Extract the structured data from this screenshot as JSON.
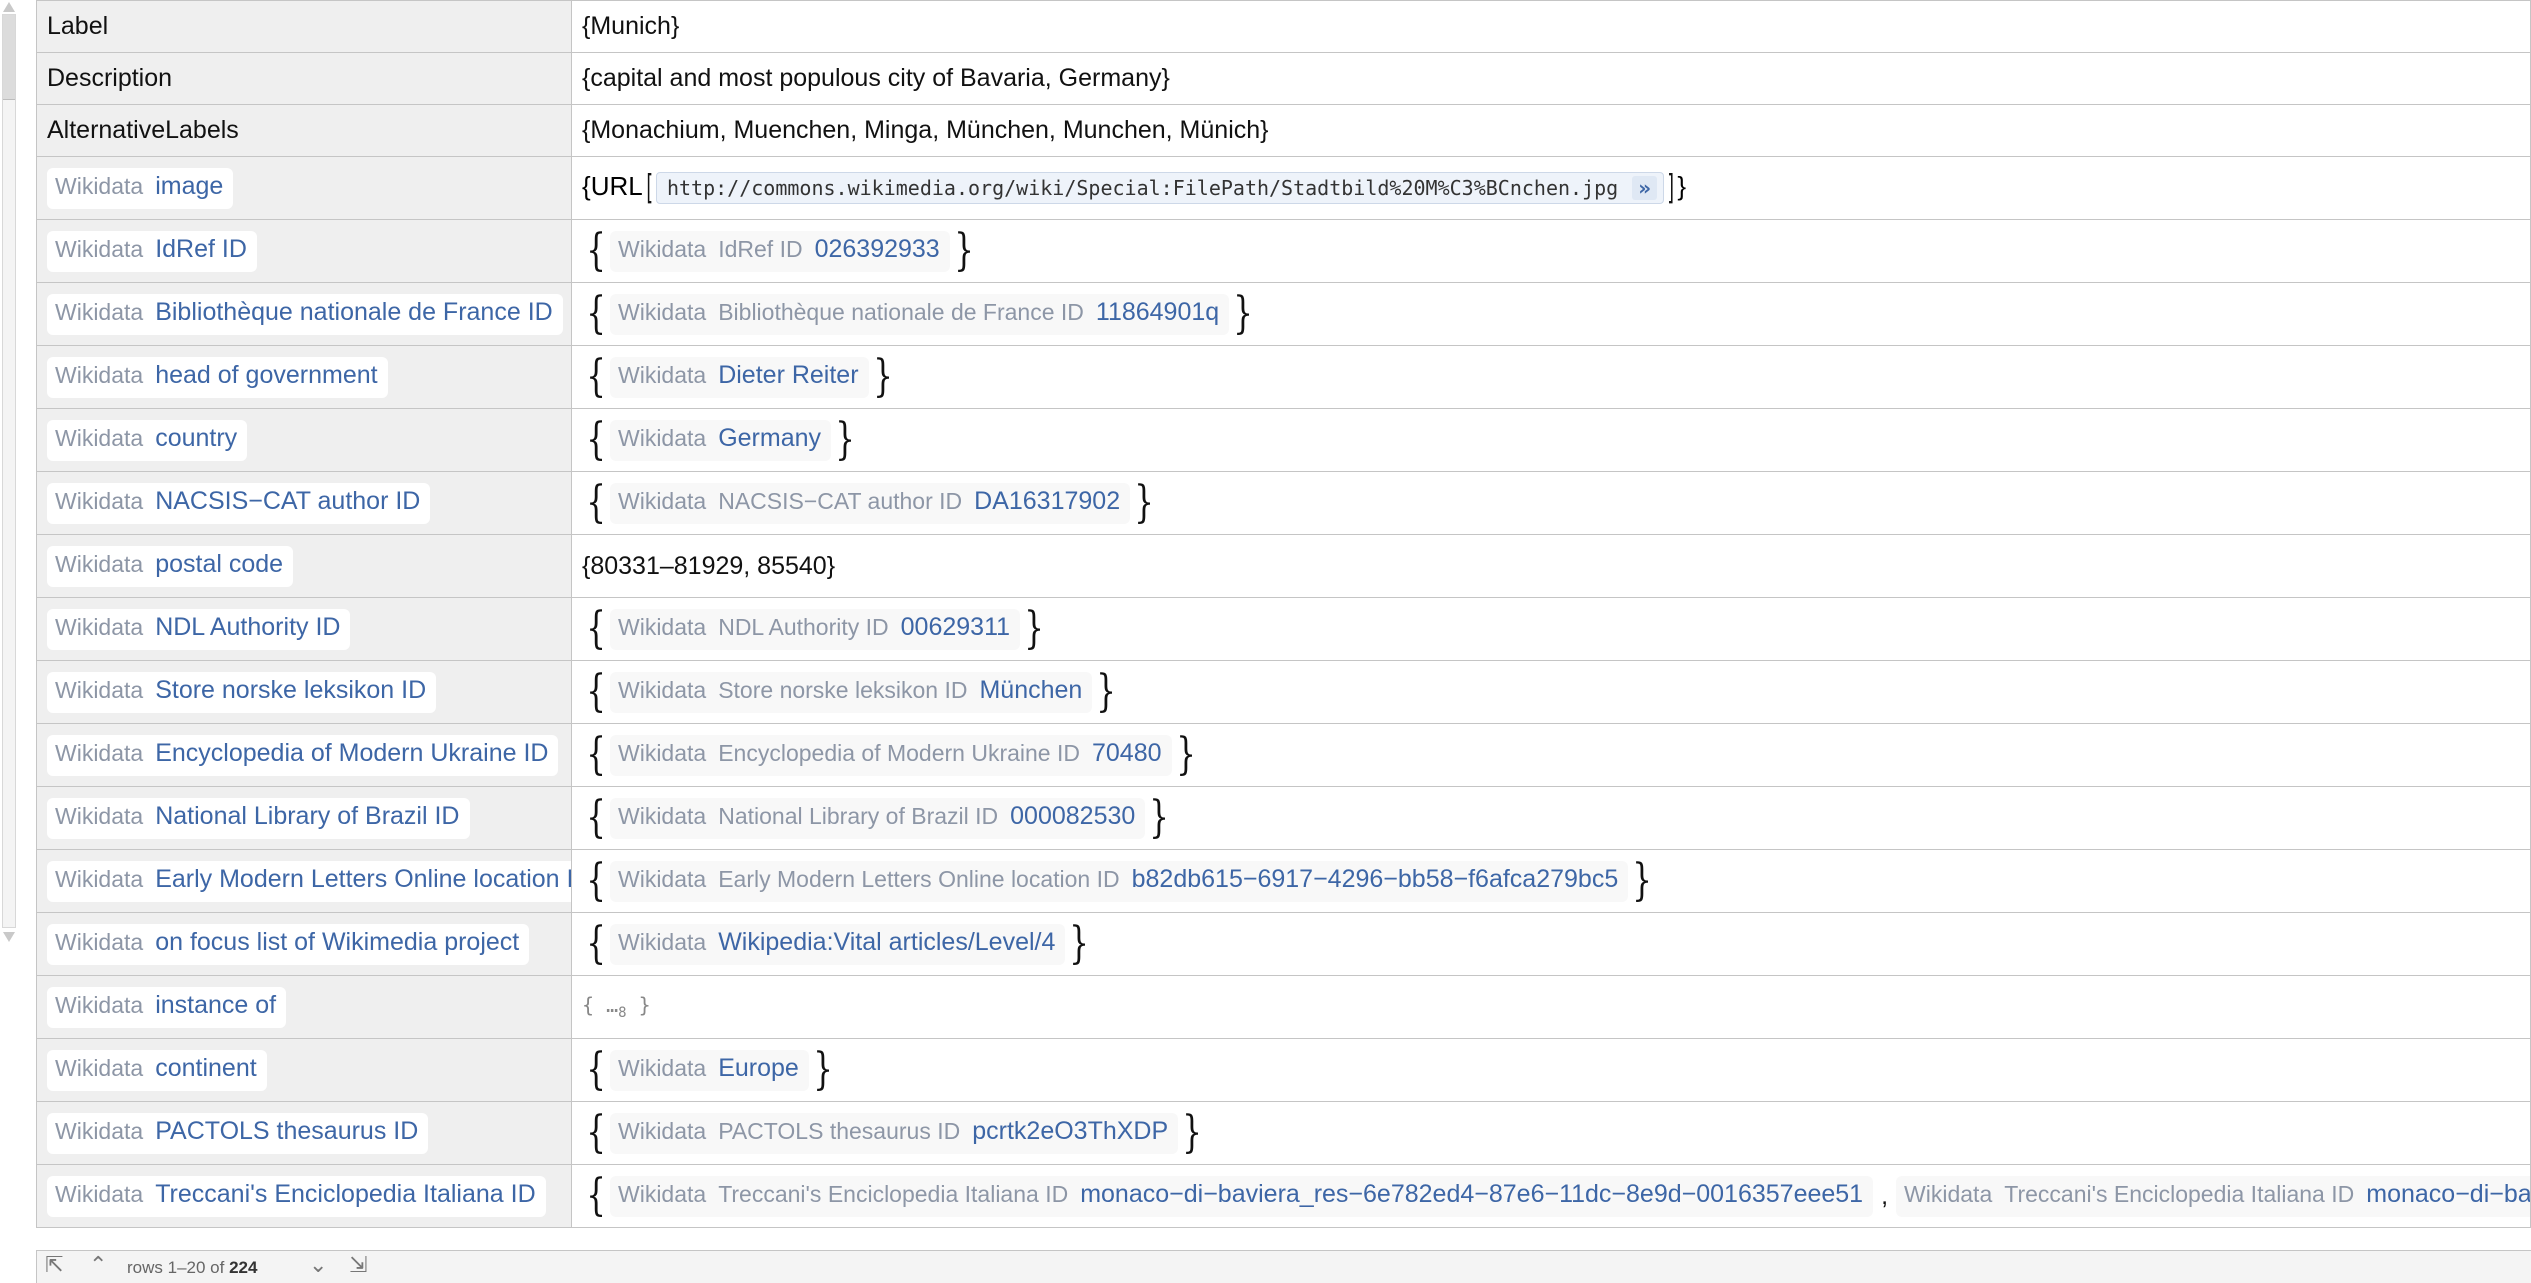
{
  "rows": [
    {
      "type": "plain",
      "key": "Label",
      "value": "{Munich}"
    },
    {
      "type": "plain",
      "key": "Description",
      "value": "{capital and most populous city of Bavaria, Germany}"
    },
    {
      "type": "plain",
      "key": "AlternativeLabels",
      "value": "{Monachium, Muenchen, Minga, München, Munchen, Münich}"
    },
    {
      "type": "url",
      "key": "image",
      "url": "http://commons.wikimedia.org/wiki/Special:FilePath/Stadtbild%20M%C3%BCnchen.jpg",
      "url_prefix": "URL",
      "arrow": "»"
    },
    {
      "type": "ent",
      "key": "IdRef ID",
      "items": [
        {
          "prop": "IdRef ID",
          "val": "026392933"
        }
      ]
    },
    {
      "type": "ent",
      "key": "Bibliothèque nationale de France ID",
      "items": [
        {
          "prop": "Bibliothèque nationale de France ID",
          "val": "11864901q"
        }
      ]
    },
    {
      "type": "ent",
      "key": "head of government",
      "items": [
        {
          "prop": "",
          "val": "Dieter Reiter"
        }
      ]
    },
    {
      "type": "ent",
      "key": "country",
      "items": [
        {
          "prop": "",
          "val": "Germany"
        }
      ]
    },
    {
      "type": "ent",
      "key": "NACSIS−CAT author ID",
      "items": [
        {
          "prop": "NACSIS−CAT author ID",
          "val": "DA16317902"
        }
      ]
    },
    {
      "type": "simple",
      "key": "postal code",
      "value": "{80331–81929, 85540}"
    },
    {
      "type": "ent",
      "key": "NDL Authority ID",
      "items": [
        {
          "prop": "NDL Authority ID",
          "val": "00629311"
        }
      ]
    },
    {
      "type": "ent",
      "key": "Store norske leksikon ID",
      "items": [
        {
          "prop": "Store norske leksikon ID",
          "val": "München"
        }
      ]
    },
    {
      "type": "ent",
      "key": "Encyclopedia of Modern Ukraine ID",
      "items": [
        {
          "prop": "Encyclopedia of Modern Ukraine ID",
          "val": "70480"
        }
      ]
    },
    {
      "type": "ent",
      "key": "National Library of Brazil ID",
      "items": [
        {
          "prop": "National Library of Brazil ID",
          "val": "000082530"
        }
      ]
    },
    {
      "type": "ent",
      "key": "Early Modern Letters Online location ID",
      "items": [
        {
          "prop": "Early Modern Letters Online location ID",
          "val": "b82db615−6917−4296−bb58−f6afca279bc5"
        }
      ]
    },
    {
      "type": "ent",
      "key": "on focus list of Wikimedia project",
      "items": [
        {
          "prop": "",
          "val": "Wikipedia:Vital articles/Level/4"
        }
      ]
    },
    {
      "type": "elided",
      "key": "instance of",
      "open": "{ ",
      "dots": "…",
      "count": "8",
      "close": " }"
    },
    {
      "type": "ent",
      "key": "continent",
      "items": [
        {
          "prop": "",
          "val": "Europe"
        }
      ]
    },
    {
      "type": "ent",
      "key": "PACTOLS thesaurus ID",
      "items": [
        {
          "prop": "PACTOLS thesaurus ID",
          "val": "pcrtk2eO3ThXDP"
        }
      ]
    },
    {
      "type": "ent",
      "key": "Treccani's Enciclopedia Italiana ID",
      "items": [
        {
          "prop": "Treccani's Enciclopedia Italiana ID",
          "val": "monaco−di−baviera_res−6e782ed4−87e6−11dc−8e9d−0016357eee51"
        },
        {
          "prop": "Treccani's Enciclopedia Italiana ID",
          "val": "monaco−di−baviera"
        }
      ]
    }
  ],
  "labels": {
    "wikidata": "Wikidata",
    "brace_open": "{",
    "brace_close": "}",
    "comma": ",",
    "square_open": "[",
    "square_close": "]"
  },
  "footer": {
    "first": "⇱",
    "prev": "⌃",
    "next": "⌄",
    "last": "⇲",
    "rows_text": "rows 1–20 of ",
    "total": "224"
  }
}
